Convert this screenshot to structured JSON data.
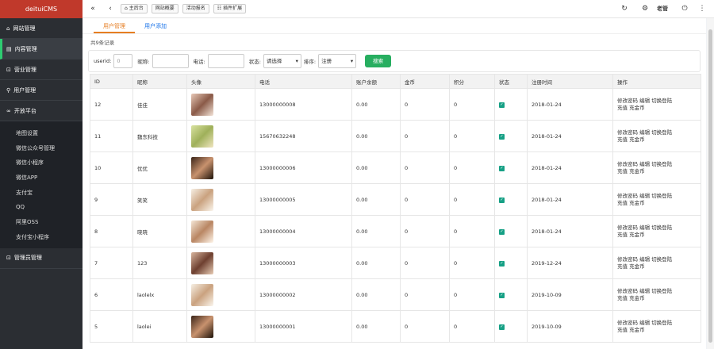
{
  "sidebar": {
    "brand": "deituiCMS",
    "items": [
      {
        "label": "网站管理",
        "icon": "house-icon"
      },
      {
        "label": "内容管理",
        "icon": "list-icon"
      },
      {
        "label": "营业管理",
        "icon": "lock-icon"
      },
      {
        "label": "用户管理",
        "icon": "user-icon"
      },
      {
        "label": "开放平台",
        "icon": "link-icon"
      }
    ],
    "sub_items": [
      "地图设置",
      "微信公众号管理",
      "微信小程序",
      "微信APP",
      "支付宝",
      "QQ",
      "阿里OSS",
      "支付宝小程序"
    ],
    "bottom_item": {
      "label": "管理员管理",
      "icon": "lock-icon"
    }
  },
  "topbar": {
    "buttons": [
      "主后台",
      "网站概要",
      "活动报名",
      "插件扩展"
    ],
    "user": "老管"
  },
  "tabs": [
    "用户管理",
    "用户添加"
  ],
  "count_text": "共9条记录",
  "filter": {
    "userid_label": "userid:",
    "userid_value": "0",
    "nick_label": "昵称:",
    "phone_label": "电话:",
    "status_label": "状态:",
    "status_value": "请选择",
    "sort_label": "排序:",
    "sort_value": "注册",
    "search_label": "搜索"
  },
  "table": {
    "headers": [
      "ID",
      "昵称",
      "头像",
      "电话",
      "账户余额",
      "金币",
      "积分",
      "状态",
      "注册时间",
      "操作"
    ],
    "rows": [
      {
        "id": "12",
        "nick": "佳佳",
        "phone": "13000000008",
        "balance": "0.00",
        "gold": "0",
        "points": "0",
        "date": "2018-01-24"
      },
      {
        "id": "11",
        "nick": "魏东科技",
        "phone": "15670632248",
        "balance": "0.00",
        "gold": "0",
        "points": "0",
        "date": "2018-01-24"
      },
      {
        "id": "10",
        "nick": "优优",
        "phone": "13000000006",
        "balance": "0.00",
        "gold": "0",
        "points": "0",
        "date": "2018-01-24"
      },
      {
        "id": "9",
        "nick": "笑笑",
        "phone": "13000000005",
        "balance": "0.00",
        "gold": "0",
        "points": "0",
        "date": "2018-01-24"
      },
      {
        "id": "8",
        "nick": "晓晓",
        "phone": "13000000004",
        "balance": "0.00",
        "gold": "0",
        "points": "0",
        "date": "2018-01-24"
      },
      {
        "id": "7",
        "nick": "123",
        "phone": "13000000003",
        "balance": "0.00",
        "gold": "0",
        "points": "0",
        "date": "2019-12-24"
      },
      {
        "id": "6",
        "nick": "laolelx",
        "phone": "13000000002",
        "balance": "0.00",
        "gold": "0",
        "points": "0",
        "date": "2019-10-09"
      },
      {
        "id": "5",
        "nick": "laolei",
        "phone": "13000000001",
        "balance": "0.00",
        "gold": "0",
        "points": "0",
        "date": "2019-10-09"
      }
    ],
    "ops_line1": "修改密码 编辑 切换登陆",
    "ops_line2": "充值 充金币"
  }
}
